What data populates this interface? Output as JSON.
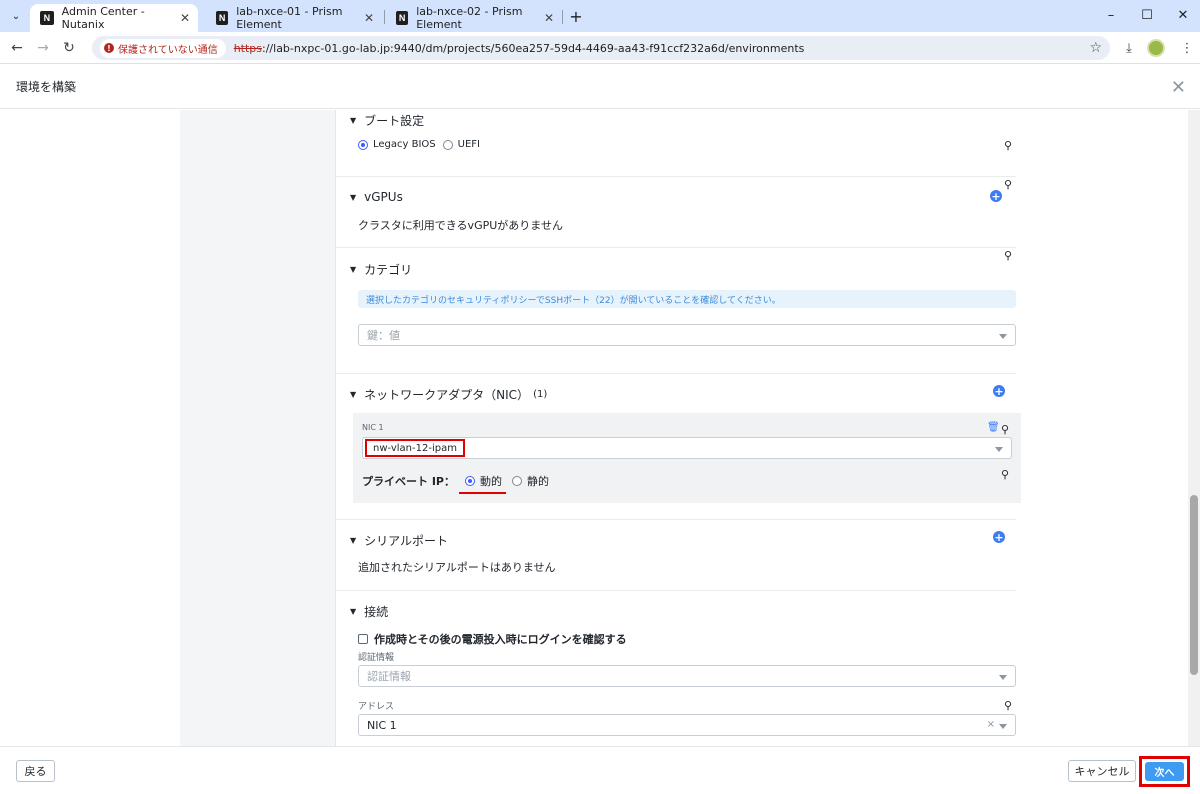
{
  "browser": {
    "tabs": [
      {
        "title": "Admin Center - Nutanix",
        "active": true
      },
      {
        "title": "lab-nxce-01 - Prism Element",
        "active": false
      },
      {
        "title": "lab-nxce-02 - Prism Element",
        "active": false
      }
    ],
    "favicon_text": "N",
    "security_label": "保護されていない通信",
    "url_scheme": "https",
    "url_rest": "://lab-nxpc-01.go-lab.jp:9440/dm/projects/560ea257-59d4-4469-aa43-f91ccf232a6d/environments"
  },
  "dialog": {
    "title": "環境を構築"
  },
  "sections": {
    "boot": {
      "title": "ブート設定",
      "options": [
        "Legacy BIOS",
        "UEFI"
      ],
      "selected": "Legacy BIOS"
    },
    "vgpu": {
      "title": "vGPUs",
      "empty_text": "クラスタに利用できるvGPUがありません"
    },
    "category": {
      "title": "カテゴリ",
      "info": "選択したカテゴリのセキュリティポリシーでSSHポート（22）が開いていることを確認してください。",
      "placeholder": "鍵：値"
    },
    "nic": {
      "title": "ネットワークアダプタ（NIC）",
      "count": "(1)",
      "nic_label": "NIC 1",
      "network_value": "nw-vlan-12-ipam",
      "private_ip_label": "プライベート IP：",
      "ip_options": [
        "動的",
        "静的"
      ],
      "ip_selected": "動的"
    },
    "serial": {
      "title": "シリアルポート",
      "empty_text": "追加されたシリアルポートはありません"
    },
    "connection": {
      "title": "接続",
      "checkbox_label": "作成時とその後の電源投入時にログインを確認する",
      "credential_label": "認証情報",
      "credential_placeholder": "認証情報",
      "address_label": "アドレス",
      "address_value": "NIC 1"
    }
  },
  "footer": {
    "back_label": "戻る",
    "cancel_label": "キャンセル",
    "next_label": "次へ"
  },
  "colors": {
    "accent": "#3d7cf2",
    "highlight": "#e00000",
    "info_bg": "#e6f3fc"
  }
}
